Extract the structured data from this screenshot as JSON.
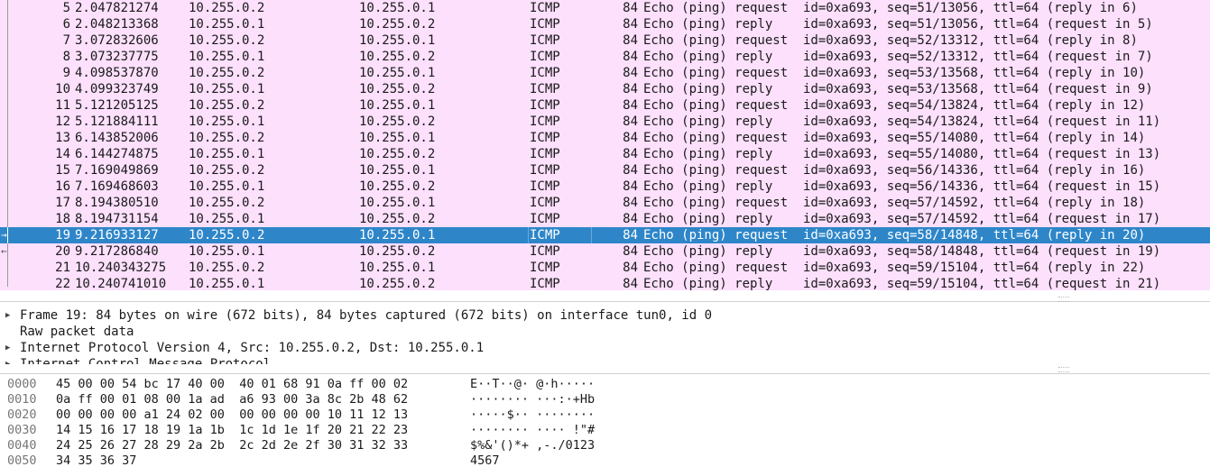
{
  "packets": [
    {
      "no": "5",
      "time": "2.047821274",
      "src": "10.255.0.2",
      "dst": "10.255.0.1",
      "proto": "ICMP",
      "len": "84",
      "info": "Echo (ping) request  id=0xa693, seq=51/13056, ttl=64 (reply in 6)"
    },
    {
      "no": "6",
      "time": "2.048213368",
      "src": "10.255.0.1",
      "dst": "10.255.0.2",
      "proto": "ICMP",
      "len": "84",
      "info": "Echo (ping) reply    id=0xa693, seq=51/13056, ttl=64 (request in 5)"
    },
    {
      "no": "7",
      "time": "3.072832606",
      "src": "10.255.0.2",
      "dst": "10.255.0.1",
      "proto": "ICMP",
      "len": "84",
      "info": "Echo (ping) request  id=0xa693, seq=52/13312, ttl=64 (reply in 8)"
    },
    {
      "no": "8",
      "time": "3.073237775",
      "src": "10.255.0.1",
      "dst": "10.255.0.2",
      "proto": "ICMP",
      "len": "84",
      "info": "Echo (ping) reply    id=0xa693, seq=52/13312, ttl=64 (request in 7)"
    },
    {
      "no": "9",
      "time": "4.098537870",
      "src": "10.255.0.2",
      "dst": "10.255.0.1",
      "proto": "ICMP",
      "len": "84",
      "info": "Echo (ping) request  id=0xa693, seq=53/13568, ttl=64 (reply in 10)"
    },
    {
      "no": "10",
      "time": "4.099323749",
      "src": "10.255.0.1",
      "dst": "10.255.0.2",
      "proto": "ICMP",
      "len": "84",
      "info": "Echo (ping) reply    id=0xa693, seq=53/13568, ttl=64 (request in 9)"
    },
    {
      "no": "11",
      "time": "5.121205125",
      "src": "10.255.0.2",
      "dst": "10.255.0.1",
      "proto": "ICMP",
      "len": "84",
      "info": "Echo (ping) request  id=0xa693, seq=54/13824, ttl=64 (reply in 12)"
    },
    {
      "no": "12",
      "time": "5.121884111",
      "src": "10.255.0.1",
      "dst": "10.255.0.2",
      "proto": "ICMP",
      "len": "84",
      "info": "Echo (ping) reply    id=0xa693, seq=54/13824, ttl=64 (request in 11)"
    },
    {
      "no": "13",
      "time": "6.143852006",
      "src": "10.255.0.2",
      "dst": "10.255.0.1",
      "proto": "ICMP",
      "len": "84",
      "info": "Echo (ping) request  id=0xa693, seq=55/14080, ttl=64 (reply in 14)"
    },
    {
      "no": "14",
      "time": "6.144274875",
      "src": "10.255.0.1",
      "dst": "10.255.0.2",
      "proto": "ICMP",
      "len": "84",
      "info": "Echo (ping) reply    id=0xa693, seq=55/14080, ttl=64 (request in 13)"
    },
    {
      "no": "15",
      "time": "7.169049869",
      "src": "10.255.0.2",
      "dst": "10.255.0.1",
      "proto": "ICMP",
      "len": "84",
      "info": "Echo (ping) request  id=0xa693, seq=56/14336, ttl=64 (reply in 16)"
    },
    {
      "no": "16",
      "time": "7.169468603",
      "src": "10.255.0.1",
      "dst": "10.255.0.2",
      "proto": "ICMP",
      "len": "84",
      "info": "Echo (ping) reply    id=0xa693, seq=56/14336, ttl=64 (request in 15)"
    },
    {
      "no": "17",
      "time": "8.194380510",
      "src": "10.255.0.2",
      "dst": "10.255.0.1",
      "proto": "ICMP",
      "len": "84",
      "info": "Echo (ping) request  id=0xa693, seq=57/14592, ttl=64 (reply in 18)"
    },
    {
      "no": "18",
      "time": "8.194731154",
      "src": "10.255.0.1",
      "dst": "10.255.0.2",
      "proto": "ICMP",
      "len": "84",
      "info": "Echo (ping) reply    id=0xa693, seq=57/14592, ttl=64 (request in 17)"
    },
    {
      "no": "19",
      "time": "9.216933127",
      "src": "10.255.0.2",
      "dst": "10.255.0.1",
      "proto": "ICMP",
      "len": "84",
      "info": "Echo (ping) request  id=0xa693, seq=58/14848, ttl=64 (reply in 20)",
      "selected": true
    },
    {
      "no": "20",
      "time": "9.217286840",
      "src": "10.255.0.1",
      "dst": "10.255.0.2",
      "proto": "ICMP",
      "len": "84",
      "info": "Echo (ping) reply    id=0xa693, seq=58/14848, ttl=64 (request in 19)"
    },
    {
      "no": "21",
      "time": "10.240343275",
      "src": "10.255.0.2",
      "dst": "10.255.0.1",
      "proto": "ICMP",
      "len": "84",
      "info": "Echo (ping) request  id=0xa693, seq=59/15104, ttl=64 (reply in 22)"
    },
    {
      "no": "22",
      "time": "10.240741010",
      "src": "10.255.0.1",
      "dst": "10.255.0.2",
      "proto": "ICMP",
      "len": "84",
      "info": "Echo (ping) reply    id=0xa693, seq=59/15104, ttl=64 (request in 21)"
    }
  ],
  "details": [
    {
      "text": "Frame 19: 84 bytes on wire (672 bits), 84 bytes captured (672 bits) on interface tun0, id 0",
      "expandable": true
    },
    {
      "text": "Raw packet data",
      "expandable": false
    },
    {
      "text": "Internet Protocol Version 4, Src: 10.255.0.2, Dst: 10.255.0.1",
      "expandable": true
    },
    {
      "text": "Internet Control Message Protocol",
      "expandable": true
    }
  ],
  "hex": [
    {
      "offset": "0000",
      "bytes": "45 00 00 54 bc 17 40 00  40 01 68 91 0a ff 00 02",
      "ascii": "E··T··@· @·h·····"
    },
    {
      "offset": "0010",
      "bytes": "0a ff 00 01 08 00 1a ad  a6 93 00 3a 8c 2b 48 62",
      "ascii": "········ ···:·+Hb"
    },
    {
      "offset": "0020",
      "bytes": "00 00 00 00 a1 24 02 00  00 00 00 00 10 11 12 13",
      "ascii": "·····$·· ········"
    },
    {
      "offset": "0030",
      "bytes": "14 15 16 17 18 19 1a 1b  1c 1d 1e 1f 20 21 22 23",
      "ascii": "········ ···· !\"#"
    },
    {
      "offset": "0040",
      "bytes": "24 25 26 27 28 29 2a 2b  2c 2d 2e 2f 30 31 32 33",
      "ascii": "$%&'()*+ ,-./0123"
    },
    {
      "offset": "0050",
      "bytes": "34 35 36 37",
      "ascii": "4567"
    }
  ],
  "colors": {
    "row_bg": "#fce0fc",
    "selected_bg": "#2e86c9",
    "selected_fg": "#ffffff"
  },
  "icons": {
    "expand": "triangle-right-icon",
    "request_arrow": "request-arrow-icon",
    "reply_arrow": "reply-arrow-icon"
  }
}
